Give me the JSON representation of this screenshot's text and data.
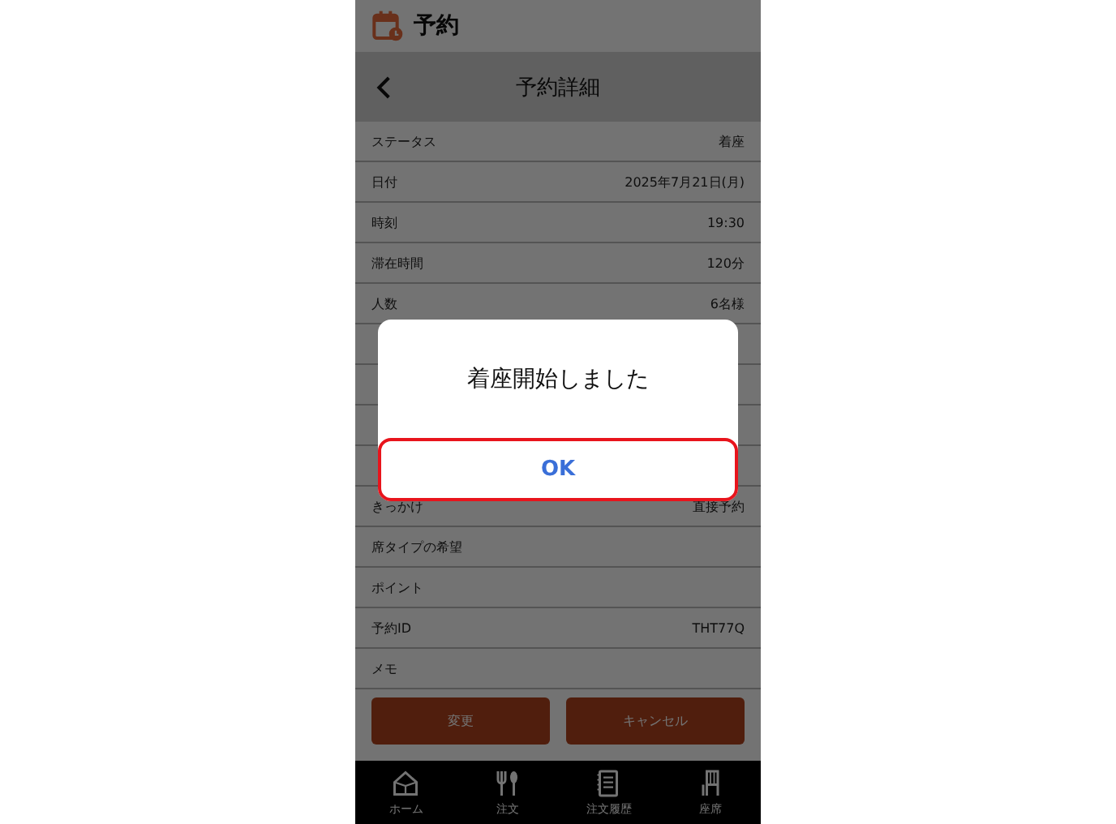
{
  "app_bar": {
    "title": "予約"
  },
  "header": {
    "title": "予約詳細"
  },
  "rows": [
    {
      "label": "ステータス",
      "value": "着座"
    },
    {
      "label": "日付",
      "value": "2025年7月21日(月)"
    },
    {
      "label": "時刻",
      "value": "19:30"
    },
    {
      "label": "滞在時間",
      "value": "120分"
    },
    {
      "label": "人数",
      "value": "6名様"
    },
    {},
    {},
    {},
    {},
    {
      "label": "きっかけ",
      "value": "直接予約"
    },
    {
      "label": "席タイプの希望"
    },
    {
      "label": "ポイント"
    },
    {
      "label": "予約ID",
      "value": "THT77Q"
    },
    {
      "label": "メモ"
    }
  ],
  "actions": [
    "変更",
    "キャンセル"
  ],
  "tab_bar": [
    {
      "kind": "home",
      "label": "ホーム"
    },
    {
      "kind": "order",
      "label": "注文"
    },
    {
      "kind": "history",
      "label": "注文履歴"
    },
    {
      "kind": "seat",
      "label": "座席"
    }
  ],
  "dialog": {
    "message": "着座開始しました",
    "button": {
      "label": "OK",
      "highlighted": true
    }
  }
}
